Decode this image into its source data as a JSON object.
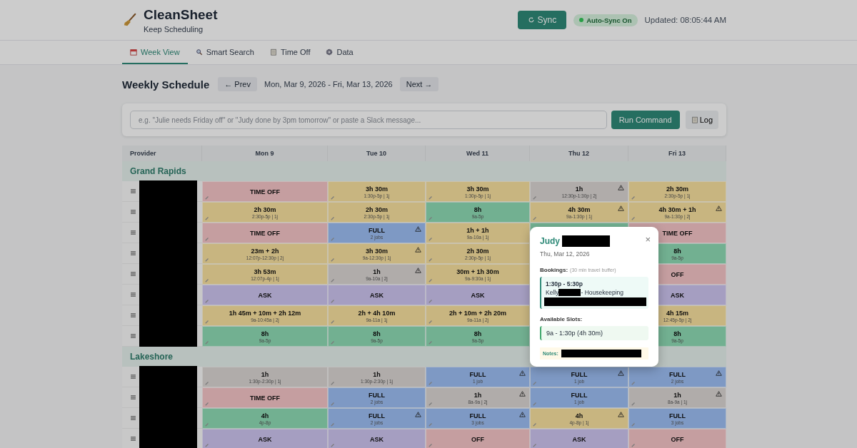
{
  "app": {
    "name": "CleanSheet",
    "tagline": "Keep Scheduling"
  },
  "header": {
    "sync_button": "Sync",
    "auto_sync": "Auto-Sync On",
    "updated": "Updated: 08:05:44 AM"
  },
  "tabs": [
    {
      "label": "Week View",
      "selected": true
    },
    {
      "label": "Smart Search",
      "selected": false
    },
    {
      "label": "Time Off",
      "selected": false
    },
    {
      "label": "Data",
      "selected": false
    }
  ],
  "schedule": {
    "title": "Weekly Schedule",
    "prev": "← Prev",
    "range": "Mon, Mar 9, 2026 - Fri, Mar 13, 2026",
    "next": "Next →"
  },
  "command": {
    "placeholder": "e.g. \"Julie needs Friday off\" or \"Judy done by 3pm tomorrow\" or paste a Slack message...",
    "run": "Run Command",
    "log": "Log"
  },
  "table": {
    "columns": [
      "Provider",
      "Mon 9",
      "Tue 10",
      "Wed 11",
      "Thu 12",
      "Fri 13"
    ],
    "groups": [
      {
        "name": "Grand Rapids",
        "rows": [
          [
            {
              "kind": "timeoff",
              "title": "TIME OFF"
            },
            {
              "kind": "partial",
              "title": "3h 30m",
              "detail": "1:30p-5p | 1j"
            },
            {
              "kind": "partial",
              "title": "3h 30m",
              "detail": "1:30p-5p | 1j"
            },
            {
              "kind": "busy",
              "title": "1h",
              "detail": "12:30p-1:30p | 2j",
              "warning": true
            },
            {
              "kind": "partial",
              "title": "2h 30m",
              "detail": "2:30p-5p | 1j"
            }
          ],
          [
            {
              "kind": "partial",
              "title": "2h 30m",
              "detail": "2:30p-5p | 1j"
            },
            {
              "kind": "partial",
              "title": "2h 30m",
              "detail": "2:30p-5p | 1j"
            },
            {
              "kind": "available",
              "title": "8h",
              "detail": "9a-5p"
            },
            {
              "kind": "partial",
              "title": "4h 30m",
              "detail": "9a-1:30p | 1j",
              "warning": true
            },
            {
              "kind": "partial",
              "title": "4h 30m + 1h",
              "detail": "9a-1:30p | 2j",
              "warning": true
            }
          ],
          [
            {
              "kind": "timeoff",
              "title": "TIME OFF"
            },
            {
              "kind": "full",
              "title": "FULL",
              "detail": "2 jobs",
              "warning": true
            },
            {
              "kind": "partial",
              "title": "1h + 1h",
              "detail": "9a-10a | 1j"
            },
            {
              "kind": "available"
            },
            {
              "kind": "timeoff",
              "title": "TIME OFF"
            }
          ],
          [
            {
              "kind": "partial",
              "title": "23m + 2h",
              "detail": "12:07p-12:30p | 2j"
            },
            {
              "kind": "partial",
              "title": "3h 30m",
              "detail": "9a-12:30p | 1j",
              "warning": true
            },
            {
              "kind": "partial",
              "title": "2h 30m",
              "detail": "2:30p-5p | 1j"
            },
            null,
            {
              "kind": "available",
              "title": "8h",
              "detail": "9a-5p"
            }
          ],
          [
            {
              "kind": "partial",
              "title": "3h 53m",
              "detail": "12:07p-4p | 1j"
            },
            {
              "kind": "busy",
              "title": "1h",
              "detail": "9a-10a | 2j",
              "warning": true
            },
            {
              "kind": "partial",
              "title": "30m + 1h 30m",
              "detail": "9a-9:30a | 1j"
            },
            null,
            {
              "kind": "off",
              "title": "OFF"
            }
          ],
          [
            {
              "kind": "ask",
              "title": "ASK"
            },
            {
              "kind": "ask",
              "title": "ASK"
            },
            {
              "kind": "ask",
              "title": "ASK"
            },
            null,
            {
              "kind": "ask",
              "title": "ASK"
            }
          ],
          [
            {
              "kind": "partial",
              "title": "1h 45m + 10m + 2h 12m",
              "detail": "9a-10:45a | 2j"
            },
            {
              "kind": "partial",
              "title": "2h + 4h 10m",
              "detail": "9a-11a | 1j"
            },
            {
              "kind": "partial",
              "title": "2h + 10m + 2h 20m",
              "detail": "9a-11a | 2j"
            },
            null,
            {
              "kind": "partial",
              "title": "4h 15m",
              "detail": "12:45p-5p | 2j"
            }
          ],
          [
            {
              "kind": "available",
              "title": "8h",
              "detail": "9a-5p"
            },
            {
              "kind": "available",
              "title": "8h",
              "detail": "9a-5p"
            },
            {
              "kind": "available",
              "title": "8h",
              "detail": "9a-5p"
            },
            null,
            {
              "kind": "available",
              "title": "8h",
              "detail": "9a-5p"
            }
          ]
        ]
      },
      {
        "name": "Lakeshore",
        "rows": [
          [
            {
              "kind": "busy",
              "title": "1h",
              "detail": "1:30p-2:30p | 1j"
            },
            {
              "kind": "busy",
              "title": "1h",
              "detail": "1:30p-2:30p | 1j"
            },
            {
              "kind": "full",
              "title": "FULL",
              "detail": "1 job",
              "warning": true
            },
            {
              "kind": "full",
              "title": "FULL",
              "detail": "1 job",
              "warning": true
            },
            {
              "kind": "full",
              "title": "FULL",
              "detail": "2 jobs",
              "warning": true
            }
          ],
          [
            {
              "kind": "timeoff",
              "title": "TIME OFF"
            },
            {
              "kind": "full",
              "title": "FULL",
              "detail": "2 jobs"
            },
            {
              "kind": "busy",
              "title": "1h",
              "detail": "8a-9a | 2j",
              "warning": true
            },
            {
              "kind": "full",
              "title": "FULL",
              "detail": "1 job"
            },
            {
              "kind": "busy",
              "title": "1h",
              "detail": "8a-9a | 1j",
              "warning": true
            }
          ],
          [
            {
              "kind": "available",
              "title": "4h",
              "detail": "4p-8p"
            },
            {
              "kind": "full",
              "title": "FULL",
              "detail": "2 jobs",
              "warning": true
            },
            {
              "kind": "full",
              "title": "FULL",
              "detail": "3 jobs",
              "warning": true
            },
            {
              "kind": "partial",
              "title": "4h",
              "detail": "4p-8p | 1j",
              "warning": true
            },
            {
              "kind": "full",
              "title": "FULL",
              "detail": "3 jobs"
            }
          ],
          [
            {
              "kind": "ask",
              "title": "ASK"
            },
            {
              "kind": "ask",
              "title": "ASK"
            },
            {
              "kind": "off",
              "title": "OFF"
            },
            {
              "kind": "ask",
              "title": "ASK"
            },
            {
              "kind": "off",
              "title": "OFF"
            }
          ]
        ]
      }
    ]
  },
  "popover": {
    "name": "Judy",
    "date": "Thu, Mar 12, 2026",
    "bookings_label": "Bookings:",
    "bookings_note": "(30 min travel buffer)",
    "booking": {
      "time": "1:30p - 5:30p",
      "client": "Kelly",
      "service": "- Housekeeping"
    },
    "slots_label": "Available Slots:",
    "slot": "9a - 1:30p (4h 30m)",
    "notes_label": "Notes:",
    "close": "×"
  }
}
